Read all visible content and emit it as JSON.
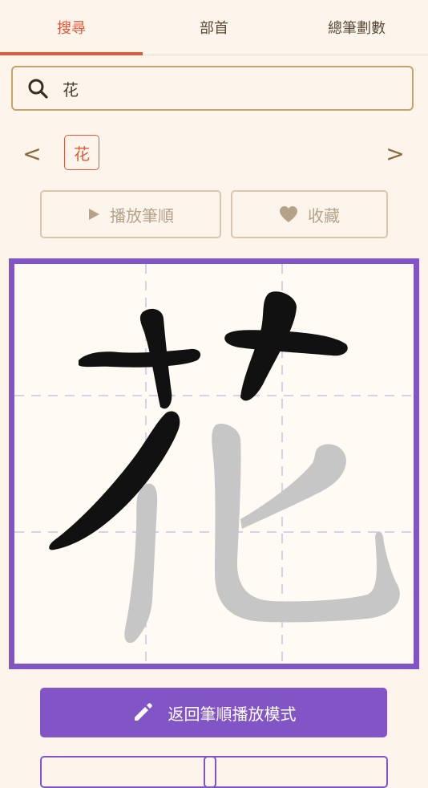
{
  "tabs": [
    {
      "label": "搜尋",
      "active": true
    },
    {
      "label": "部首",
      "active": false
    },
    {
      "label": "總筆劃數",
      "active": false
    }
  ],
  "search": {
    "value": "花",
    "placeholder": ""
  },
  "nav": {
    "prev": "<",
    "next": ">"
  },
  "result_chip": "花",
  "actions": {
    "play_strokes": "播放筆順",
    "favorite": "收藏"
  },
  "character": "花",
  "primary_button": "返回筆順播放模式",
  "colors": {
    "accent": "#e05a3a",
    "purple": "#8255c6",
    "background": "#fdf5ec",
    "stroke_done": "#111111",
    "stroke_pending": "#c6c6c6"
  }
}
